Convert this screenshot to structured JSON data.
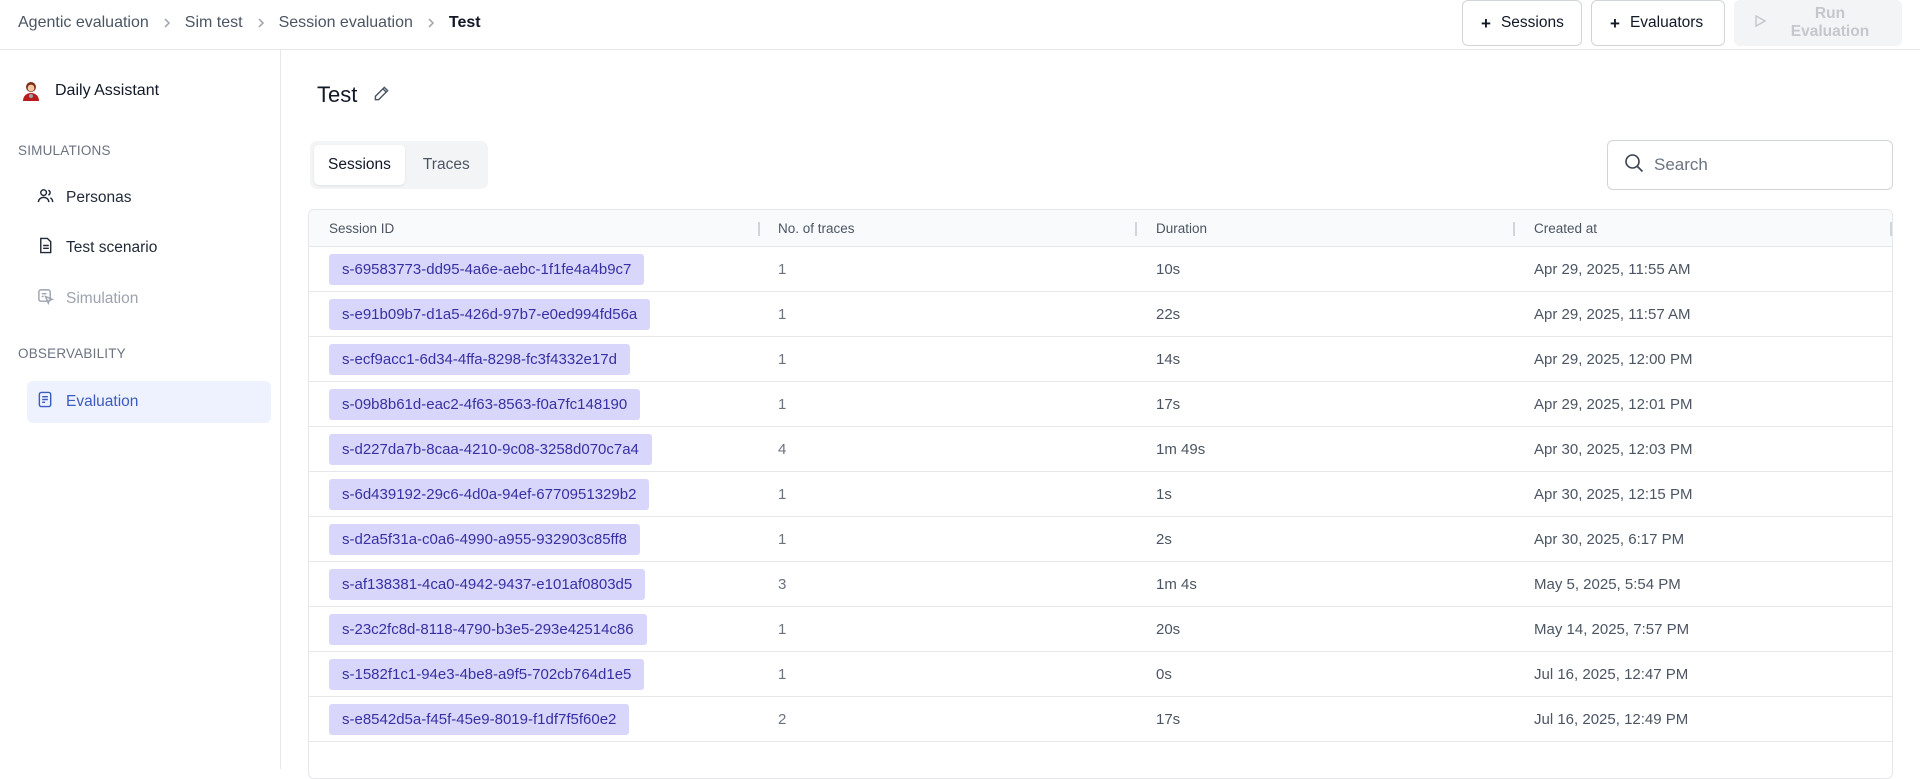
{
  "breadcrumb": [
    {
      "label": "Agentic evaluation"
    },
    {
      "label": "Sim test"
    },
    {
      "label": "Session evaluation"
    },
    {
      "label": "Test"
    }
  ],
  "actions": {
    "sessions_label": "Sessions",
    "evaluators_label": "Evaluators",
    "run_label": "Run Evaluation"
  },
  "sidebar": {
    "agent_name": "Daily Assistant",
    "simulations_heading": "SIMULATIONS",
    "simulations_items": [
      {
        "label": "Personas",
        "icon": "users-icon"
      },
      {
        "label": "Test scenario",
        "icon": "document-icon"
      },
      {
        "label": "Simulation",
        "icon": "simulation-icon"
      }
    ],
    "observability_heading": "OBSERVABILITY",
    "observability_items": [
      {
        "label": "Evaluation",
        "icon": "evaluation-icon"
      }
    ]
  },
  "page": {
    "title": "Test"
  },
  "tabs": [
    {
      "label": "Sessions",
      "active": true
    },
    {
      "label": "Traces",
      "active": false
    }
  ],
  "search": {
    "placeholder": "Search"
  },
  "table": {
    "headers": [
      "Session ID",
      "No. of traces",
      "Duration",
      "Created at"
    ],
    "rows": [
      {
        "id": "s-69583773-dd95-4a6e-aebc-1f1fe4a4b9c7",
        "traces": "1",
        "duration": "10s",
        "created": "Apr 29, 2025, 11:55 AM"
      },
      {
        "id": "s-e91b09b7-d1a5-426d-97b7-e0ed994fd56a",
        "traces": "1",
        "duration": "22s",
        "created": "Apr 29, 2025, 11:57 AM"
      },
      {
        "id": "s-ecf9acc1-6d34-4ffa-8298-fc3f4332e17d",
        "traces": "1",
        "duration": "14s",
        "created": "Apr 29, 2025, 12:00 PM"
      },
      {
        "id": "s-09b8b61d-eac2-4f63-8563-f0a7fc148190",
        "traces": "1",
        "duration": "17s",
        "created": "Apr 29, 2025, 12:01 PM"
      },
      {
        "id": "s-d227da7b-8caa-4210-9c08-3258d070c7a4",
        "traces": "4",
        "duration": "1m 49s",
        "created": "Apr 30, 2025, 12:03 PM"
      },
      {
        "id": "s-6d439192-29c6-4d0a-94ef-6770951329b2",
        "traces": "1",
        "duration": "1s",
        "created": "Apr 30, 2025, 12:15 PM"
      },
      {
        "id": "s-d2a5f31a-c0a6-4990-a955-932903c85ff8",
        "traces": "1",
        "duration": "2s",
        "created": "Apr 30, 2025, 6:17 PM"
      },
      {
        "id": "s-af138381-4ca0-4942-9437-e101af0803d5",
        "traces": "3",
        "duration": "1m 4s",
        "created": "May 5, 2025, 5:54 PM"
      },
      {
        "id": "s-23c2fc8d-8118-4790-b3e5-293e42514c86",
        "traces": "1",
        "duration": "20s",
        "created": "May 14, 2025, 7:57 PM"
      },
      {
        "id": "s-1582f1c1-94e3-4be8-a9f5-702cb764d1e5",
        "traces": "1",
        "duration": "0s",
        "created": "Jul 16, 2025, 12:47 PM"
      },
      {
        "id": "s-e8542d5a-f45f-45e9-8019-f1df7f5f60e2",
        "traces": "2",
        "duration": "17s",
        "created": "Jul 16, 2025, 12:49 PM"
      }
    ]
  }
}
